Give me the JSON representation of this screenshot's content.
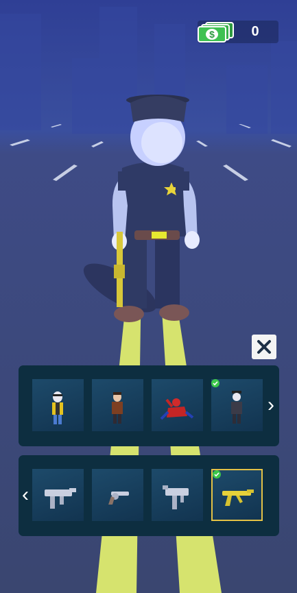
{
  "hud": {
    "currency_icon": "dollar-bill-stack-icon",
    "currency_amount": "0"
  },
  "close_icon": "close-icon",
  "skins": {
    "next_arrow": "›",
    "items": [
      {
        "icon": "yellow-vest-skin-icon",
        "owned": false,
        "selected": false
      },
      {
        "icon": "brown-jacket-skin-icon",
        "owned": false,
        "selected": false
      },
      {
        "icon": "spider-hero-skin-icon",
        "owned": false,
        "selected": false
      },
      {
        "icon": "police-skin-icon",
        "owned": true,
        "selected": false
      }
    ]
  },
  "weapons": {
    "prev_arrow": "‹",
    "items": [
      {
        "icon": "smg-icon",
        "owned": false,
        "selected": false
      },
      {
        "icon": "revolver-icon",
        "owned": false,
        "selected": false
      },
      {
        "icon": "uzi-icon",
        "owned": false,
        "selected": false
      },
      {
        "icon": "golden-rifle-icon",
        "owned": true,
        "selected": true
      }
    ]
  },
  "colors": {
    "panel_bg": "#0d2e40",
    "slot_bg": "#1a4464",
    "selected_border": "#e4c246",
    "check_green": "#3cc64a",
    "road_line": "#d6e36e"
  }
}
